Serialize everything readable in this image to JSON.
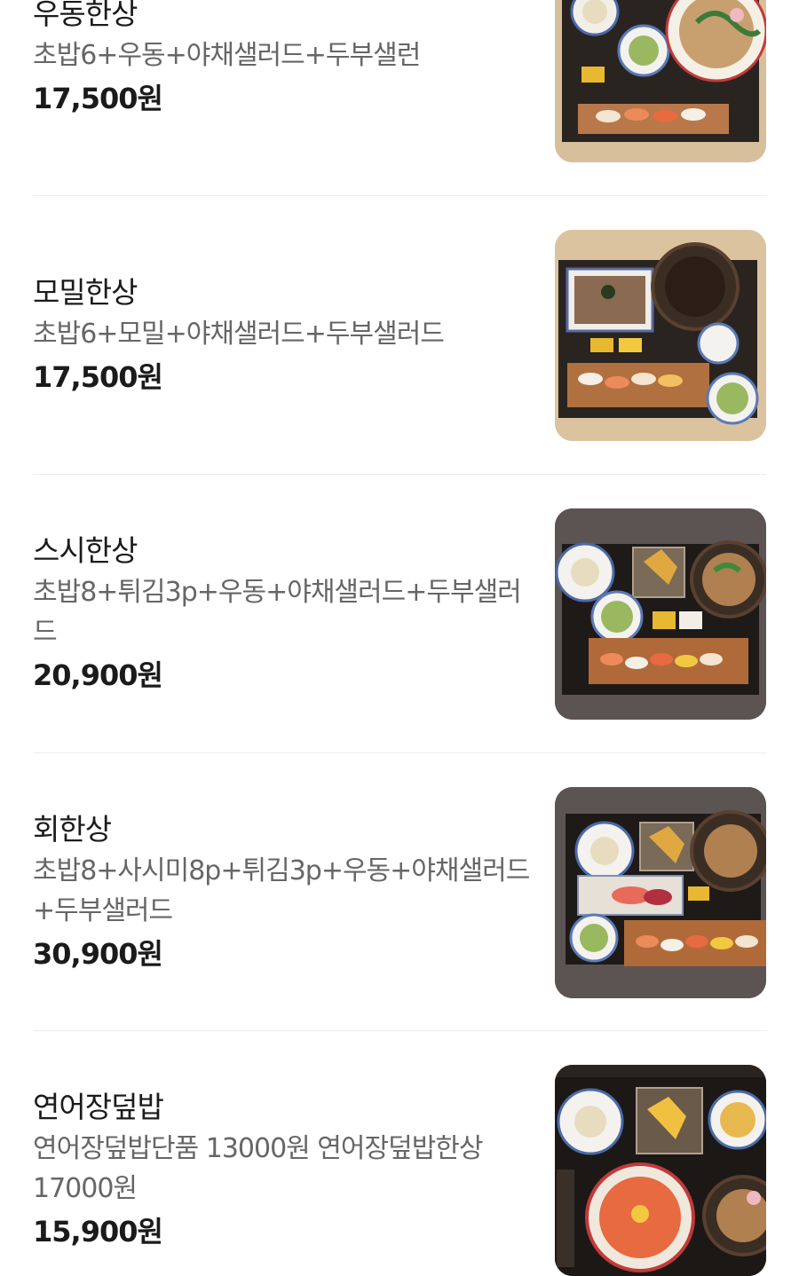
{
  "menu": {
    "items": [
      {
        "name": "우동한상",
        "desc": "초밥6+우동+야채샐러드+두부샐런",
        "price": "17,500원",
        "image": "udon-set-photo"
      },
      {
        "name": "모밀한상",
        "desc": "초밥6+모밀+야채샐러드+두부샐러드",
        "price": "17,500원",
        "image": "soba-set-photo"
      },
      {
        "name": "스시한상",
        "desc": "초밥8+튀김3p+우동+야채샐러드+두부샐러드",
        "price": "20,900원",
        "image": "sushi-set-photo"
      },
      {
        "name": "회한상",
        "desc": "초밥8+사시미8p+튀김3p+우동+야채샐러드+두부샐러드",
        "price": "30,900원",
        "image": "sashimi-set-photo"
      },
      {
        "name": "연어장덮밥",
        "desc": "연어장덮밥단품 13000원 연어장덮밥한상 17000원",
        "price": "15,900원",
        "image": "salmon-bowl-photo"
      }
    ]
  }
}
